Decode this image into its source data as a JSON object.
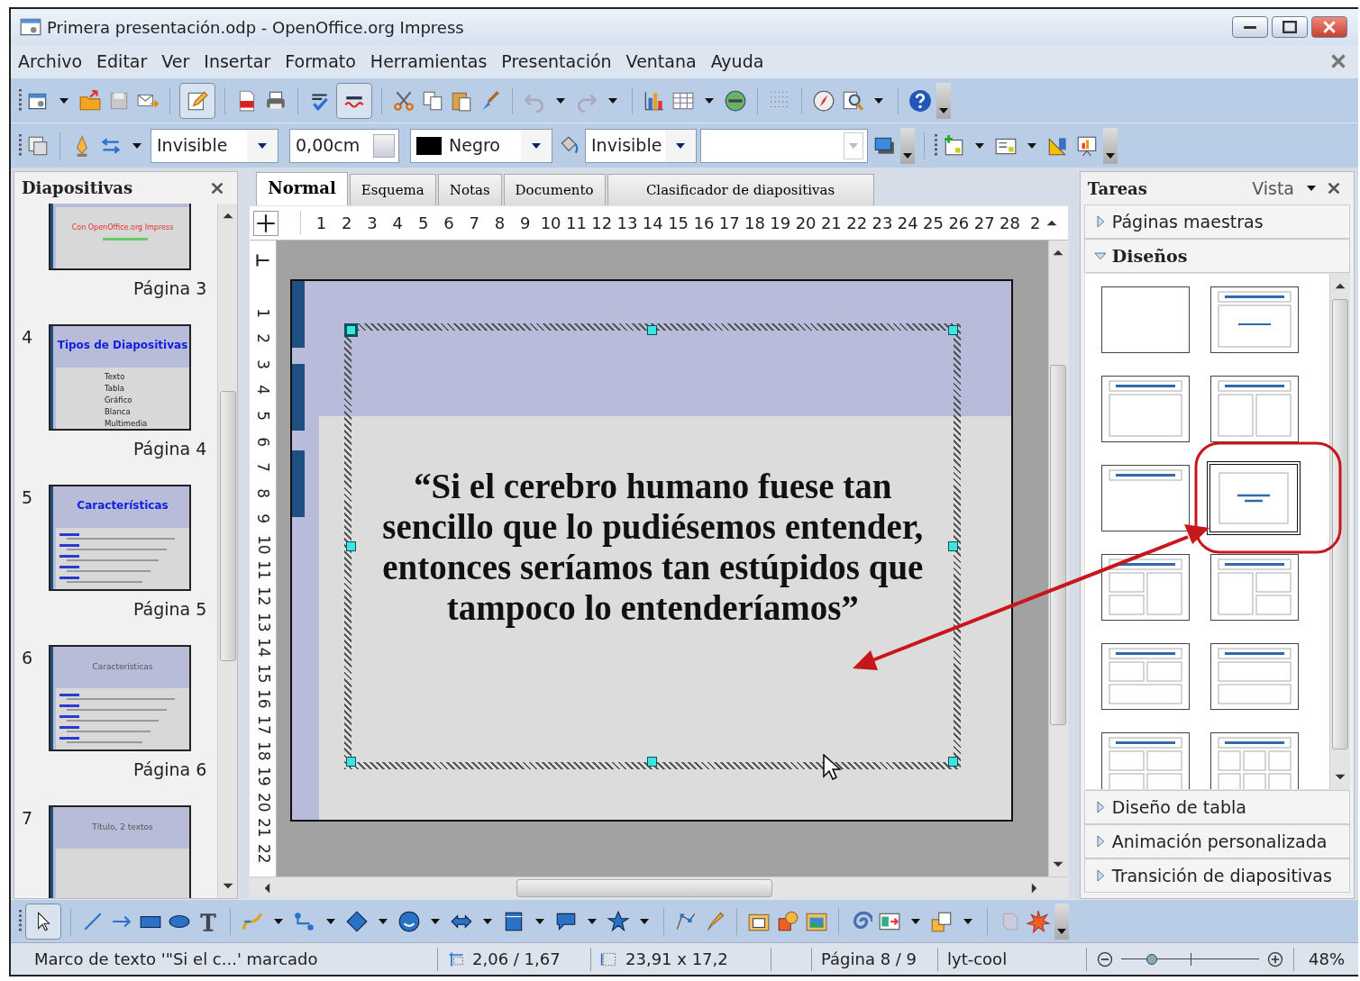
{
  "window": {
    "title": "Primera presentación.odp - OpenOffice.org Impress"
  },
  "menu": [
    "Archivo",
    "Editar",
    "Ver",
    "Insertar",
    "Formato",
    "Herramientas",
    "Presentación",
    "Ventana",
    "Ayuda"
  ],
  "line_toolbar": {
    "line_style": "Invisible",
    "line_width": "0,00cm",
    "line_color": "Negro",
    "area_style": "Invisible"
  },
  "slides_panel": {
    "title": "Diapositivas",
    "slides": [
      {
        "label": "Página 3",
        "kind": "title-slide",
        "title": "Con OpenOffice.org Impress"
      },
      {
        "number": "4",
        "label": "Página 4",
        "kind": "bullets",
        "title": "Tipos de Diapositivas",
        "bullets": [
          "Texto",
          "Tabla",
          "Gráfico",
          "Blanca",
          "Multimedia"
        ]
      },
      {
        "number": "5",
        "label": "Página 5",
        "kind": "outline-bold",
        "title": "Características"
      },
      {
        "number": "6",
        "label": "Página 6",
        "kind": "outline-plain",
        "title": "Características"
      },
      {
        "number": "7",
        "kind": "title-plain",
        "title": "Título, 2 textos"
      }
    ]
  },
  "tabs": [
    {
      "label": "Normal",
      "selected": true
    },
    {
      "label": "Esquema",
      "selected": false
    },
    {
      "label": "Notas",
      "selected": false
    },
    {
      "label": "Documento",
      "selected": false
    },
    {
      "label": "Clasificador de diapositivas",
      "selected": false
    }
  ],
  "rulers": {
    "horizontal": [
      "1",
      "2",
      "3",
      "4",
      "5",
      "6",
      "7",
      "8",
      "9",
      "10",
      "11",
      "12",
      "13",
      "14",
      "15",
      "16",
      "17",
      "18",
      "19",
      "20",
      "21",
      "22",
      "23",
      "24",
      "25",
      "26",
      "27",
      "28",
      "2"
    ],
    "vertical": [
      "1",
      "2",
      "3",
      "4",
      "5",
      "6",
      "7",
      "8",
      "9",
      "10",
      "11",
      "12",
      "13",
      "14",
      "15",
      "16",
      "17",
      "18",
      "19",
      "20",
      "21",
      "22"
    ]
  },
  "slide": {
    "quote": "“Si el cerebro humano fuese tan sencillo que lo pudiésemos entender, entonces seríamos tan estúpidos que tampoco lo entenderíamos”",
    "selected": true
  },
  "tasks_panel": {
    "title": "Tareas",
    "view_menu": "Vista",
    "sections": [
      {
        "label": "Páginas maestras",
        "expanded": false
      },
      {
        "label": "Diseños",
        "expanded": true,
        "layouts": [
          {
            "kind": "blank",
            "selected": false
          },
          {
            "kind": "title-slide",
            "selected": false
          },
          {
            "kind": "title-content",
            "selected": false
          },
          {
            "kind": "title-2col",
            "selected": false
          },
          {
            "kind": "title-only",
            "selected": false
          },
          {
            "kind": "centered-text",
            "selected": true
          },
          {
            "kind": "title-2left-1right",
            "selected": false
          },
          {
            "kind": "title-1left-2right",
            "selected": false
          },
          {
            "kind": "title-2top-1bottom",
            "selected": false
          },
          {
            "kind": "title-2rows",
            "selected": false
          },
          {
            "kind": "title-4",
            "selected": false
          },
          {
            "kind": "title-6",
            "selected": false
          }
        ]
      },
      {
        "label": "Diseño de tabla",
        "expanded": false
      },
      {
        "label": "Animación personalizada",
        "expanded": false
      },
      {
        "label": "Transición de diapositivas",
        "expanded": false
      }
    ]
  },
  "status_bar": {
    "message": "Marco de texto '\"Si el c...' marcado",
    "position": "2,06 / 1,67",
    "size": "23,91 x 17,2",
    "page": "Página 8 / 9",
    "master": "lyt-cool",
    "zoom": {
      "level": 0.22,
      "label": "48%"
    }
  }
}
